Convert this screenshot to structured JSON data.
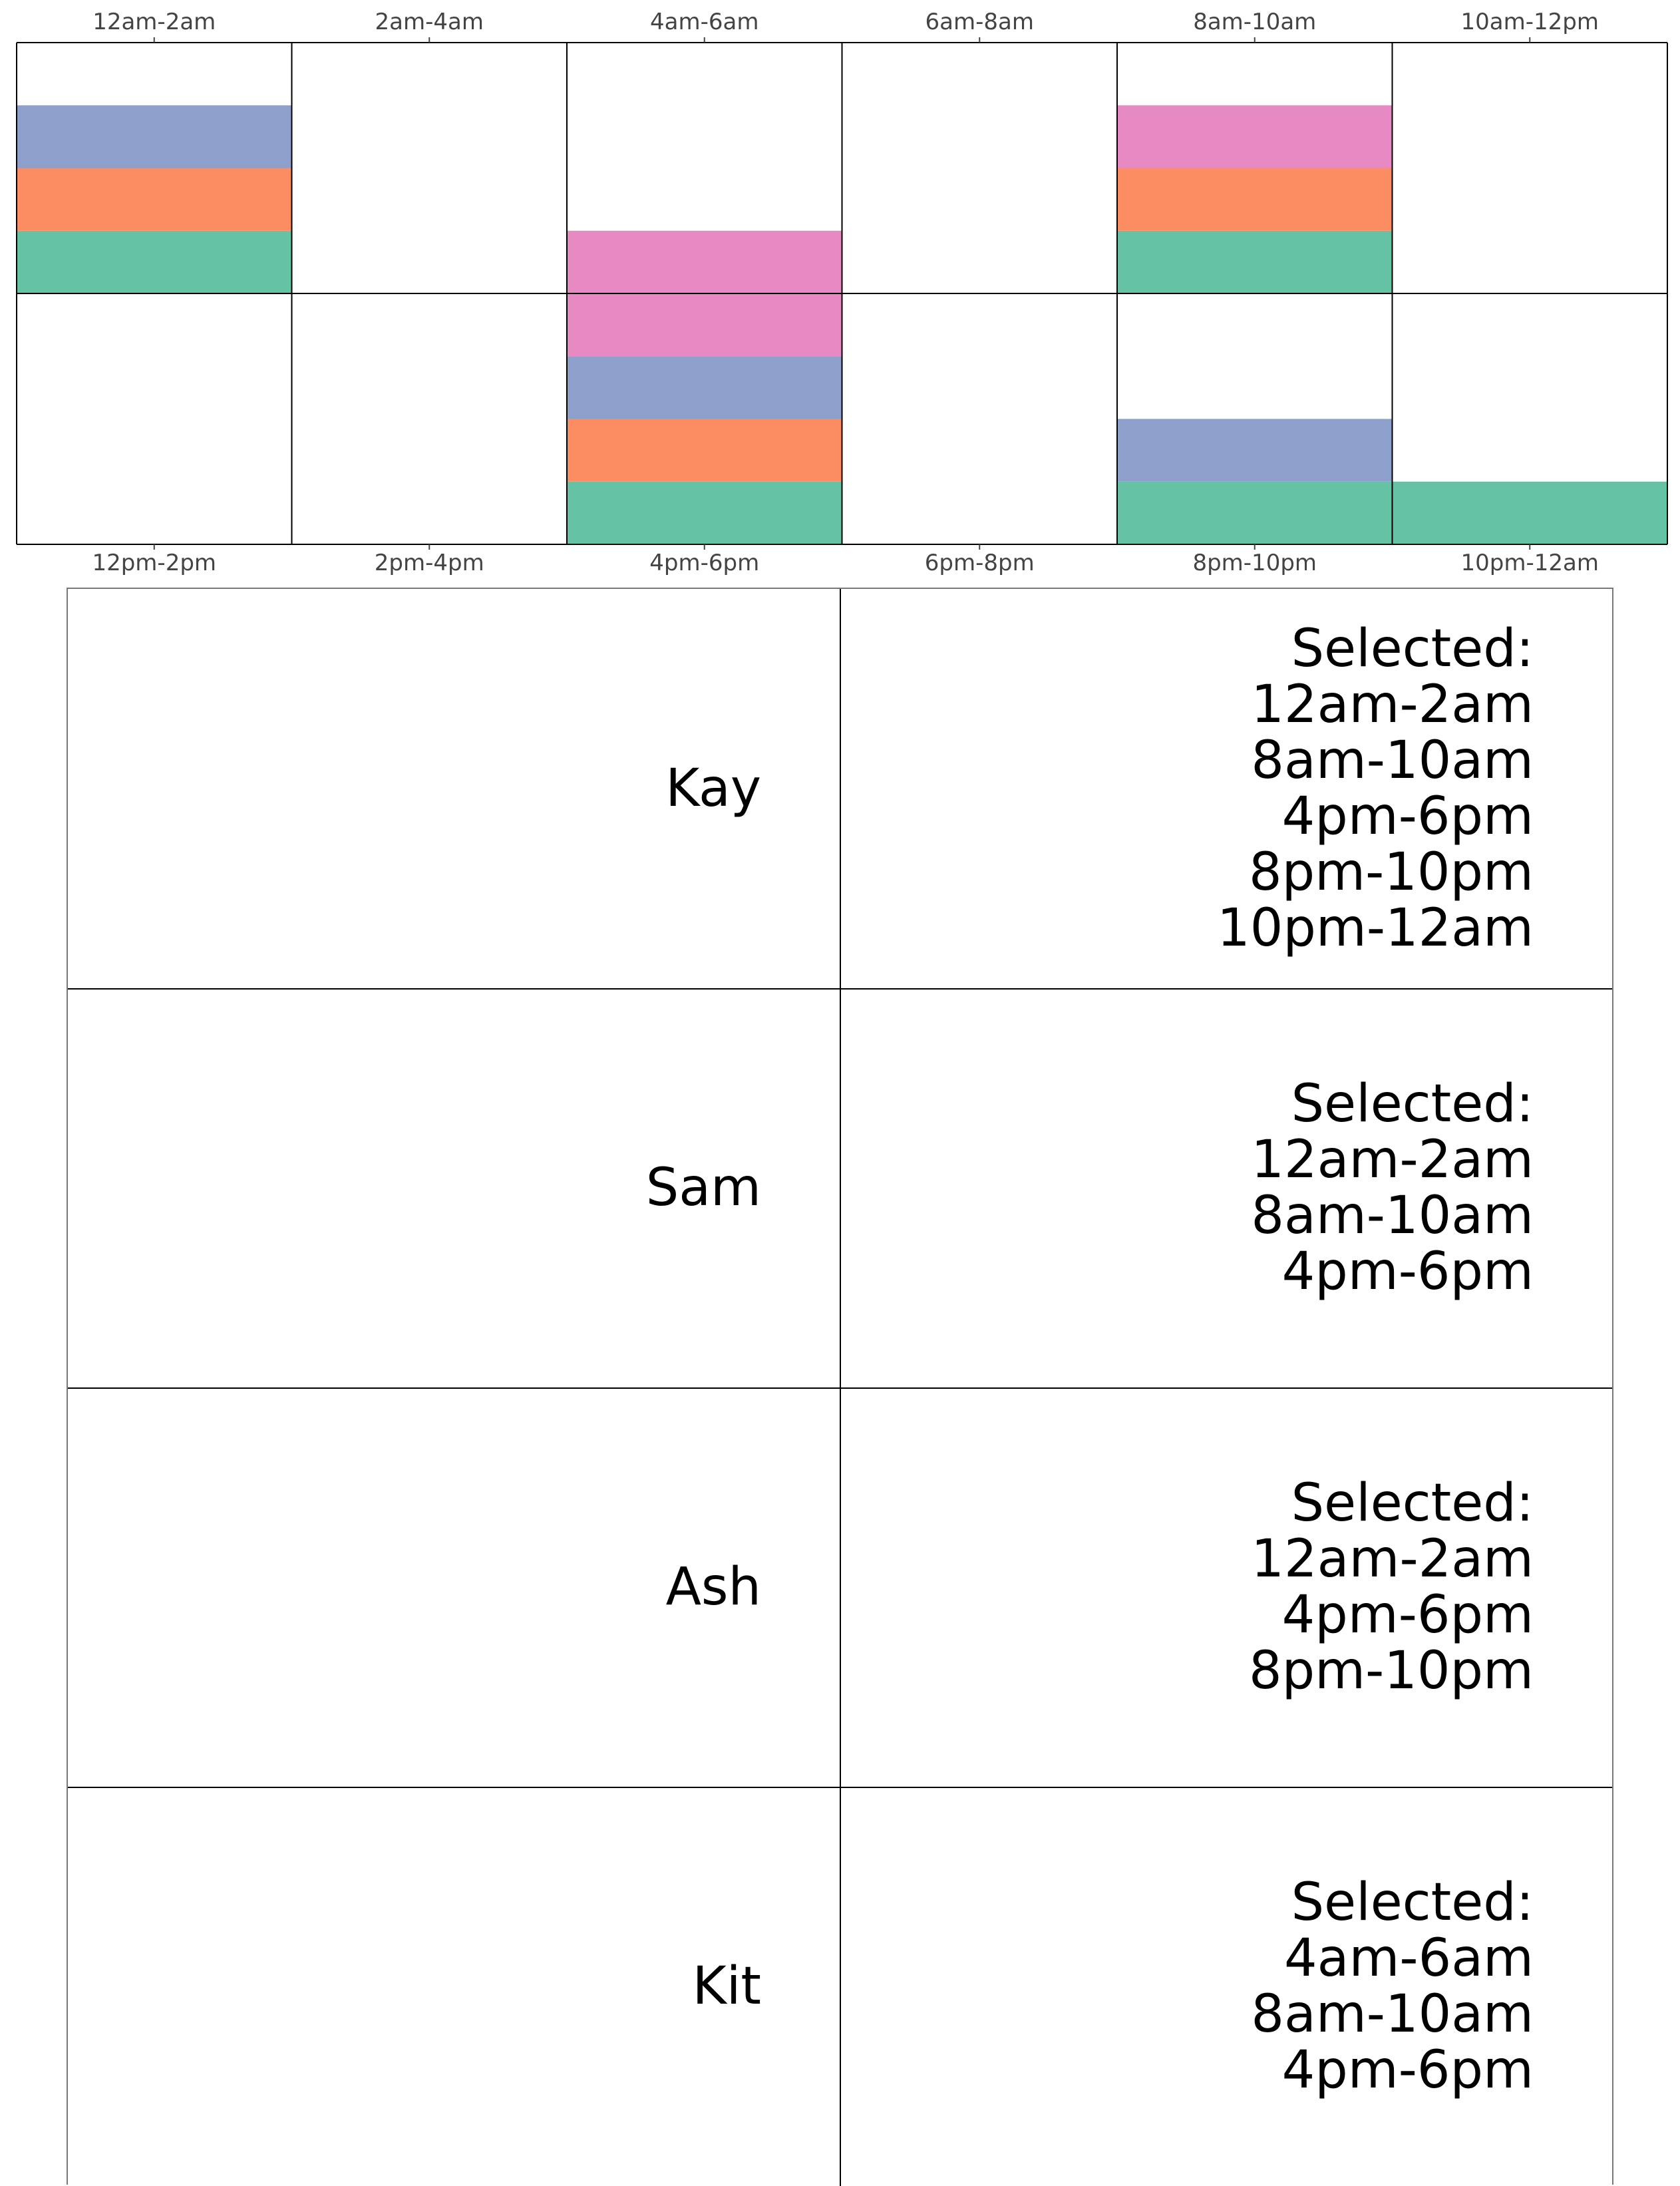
{
  "chart_data": {
    "type": "heatmap",
    "title": "",
    "top_labels": [
      "12am-2am",
      "2am-4am",
      "4am-6am",
      "6am-8am",
      "8am-10am",
      "10am-12pm"
    ],
    "bottom_labels": [
      "12pm-2pm",
      "2pm-4pm",
      "4pm-6pm",
      "6pm-8pm",
      "8pm-10pm",
      "10pm-12am"
    ],
    "cell_capacity": 4,
    "series": [
      {
        "color": "#66c2a5"
      },
      {
        "color": "#fc8d62"
      },
      {
        "color": "#8da0cb"
      },
      {
        "color": "#e78ac3"
      }
    ],
    "cells": [
      {
        "row": 0,
        "col": 0,
        "stack": [
          0,
          1,
          2
        ]
      },
      {
        "row": 0,
        "col": 2,
        "stack": [
          3
        ]
      },
      {
        "row": 0,
        "col": 4,
        "stack": [
          0,
          1,
          3
        ]
      },
      {
        "row": 1,
        "col": 2,
        "stack": [
          0,
          1,
          2,
          3
        ]
      },
      {
        "row": 1,
        "col": 4,
        "stack": [
          0,
          2
        ]
      },
      {
        "row": 1,
        "col": 5,
        "stack": [
          0
        ]
      }
    ]
  },
  "people": [
    {
      "name": "Kay",
      "selected_heading": "Selected:",
      "slots": [
        "12am-2am",
        "8am-10am",
        "4pm-6pm",
        "8pm-10pm",
        "10pm-12am"
      ]
    },
    {
      "name": "Sam",
      "selected_heading": "Selected:",
      "slots": [
        "12am-2am",
        "8am-10am",
        "4pm-6pm"
      ]
    },
    {
      "name": "Ash",
      "selected_heading": "Selected:",
      "slots": [
        "12am-2am",
        "4pm-6pm",
        "8pm-10pm"
      ]
    },
    {
      "name": "Kit",
      "selected_heading": "Selected:",
      "slots": [
        "4am-6am",
        "8am-10am",
        "4pm-6pm"
      ]
    }
  ]
}
